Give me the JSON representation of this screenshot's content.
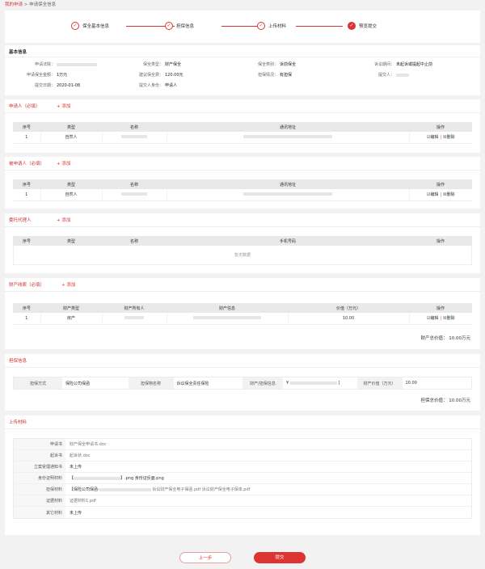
{
  "breadcrumb": {
    "root": "我的申请",
    "sep": ">",
    "current": "申请保全信息"
  },
  "steps": [
    {
      "icon": "✓",
      "label": "保全基本信息"
    },
    {
      "icon": "✓",
      "label": "担保信息"
    },
    {
      "icon": "✓",
      "label": "上传材料"
    },
    {
      "icon": "✓",
      "label": "预览提交"
    }
  ],
  "basic": {
    "title": "基本信息",
    "court_label": "申请法院：",
    "type_label": "保全类型：",
    "type_value": "财产保全",
    "category_label": "保全类别：",
    "category_value": "诉前保全",
    "period_label": "诉讼期间：",
    "period_value": "未起诉或提起中止前",
    "amount_label": "申请保全金额：",
    "amount_value": "1万元",
    "fee_label": "建议保全费：",
    "fee_value": "120.00元",
    "guarantee_label": "担保情况：",
    "guarantee_value": "有担保",
    "submitter_label": "提交人：",
    "date_label": "提交日期：",
    "date_value": "2020-01-08",
    "identity_label": "提交人身份：",
    "identity_value": "申请人"
  },
  "applicant": {
    "title": "申请人（必填）",
    "add": "+ 添加",
    "headers": [
      "序号",
      "类型",
      "名称",
      "通讯地址",
      "操作"
    ],
    "rows": [
      {
        "no": "1",
        "type": "自然人",
        "edit": "☑编辑",
        "sep": "|",
        "del": "☒删除"
      }
    ]
  },
  "respondent": {
    "title": "被申请人（必填）",
    "add": "+ 添加",
    "headers": [
      "序号",
      "类型",
      "名称",
      "通讯地址",
      "操作"
    ],
    "rows": [
      {
        "no": "1",
        "type": "自然人",
        "edit": "☑编辑",
        "sep": "|",
        "del": "☒删除"
      }
    ]
  },
  "agent": {
    "title": "委托代理人",
    "add": "+ 添加",
    "headers": [
      "序号",
      "类型",
      "名称",
      "手机号码",
      "操作"
    ],
    "empty": "暂无数据"
  },
  "property": {
    "title": "财产线索（必填）",
    "add": "+ 添加",
    "headers": [
      "序号",
      "财产类型",
      "财产所有人",
      "财产信息",
      "价值（万元）",
      "操作"
    ],
    "rows": [
      {
        "no": "1",
        "type": "房产",
        "value": "10.00",
        "edit": "☑编辑",
        "sep": "|",
        "del": "☒删除"
      }
    ],
    "total": "财产总价值：  10.00万元"
  },
  "guarantee": {
    "title": "担保信息",
    "method_label": "担保方式",
    "method_value": "保险公司保函",
    "org_label": "担保物名称",
    "org_value": "诉讼保全责任保险",
    "contact_label": "财产/担保信息",
    "contact_value": "¥",
    "contact_suffix": "]",
    "worth_label": "财产价值（万元）",
    "worth_value": "10.00",
    "total": "担保总价值：  10.00万元"
  },
  "materials": {
    "title": "上传材料",
    "rows": [
      {
        "label": "申请书",
        "value": "财产保全申请书.doc"
      },
      {
        "label": "起诉书",
        "value": "起诉状.doc"
      },
      {
        "label": "立案受理通知书",
        "value": "未上传",
        "dark": true
      },
      {
        "label": "身份证明材料",
        "value": "【",
        "suffix": "】.png    身份证反面.png"
      },
      {
        "label": "担保材料",
        "value": "【保险公司保函-",
        "suffix": "诉讼财产保全电子保函.pdf  诉讼财产保全电子保单.pdf"
      },
      {
        "label": "证据材料",
        "value": "证据材料1.pdf"
      },
      {
        "label": "其它材料",
        "value": "未上传",
        "dark": true
      }
    ]
  },
  "buttons": {
    "prev": "上一步",
    "submit": "提交"
  },
  "colors": {
    "accent": "#dd3333",
    "bg": "#f2f2f2"
  }
}
